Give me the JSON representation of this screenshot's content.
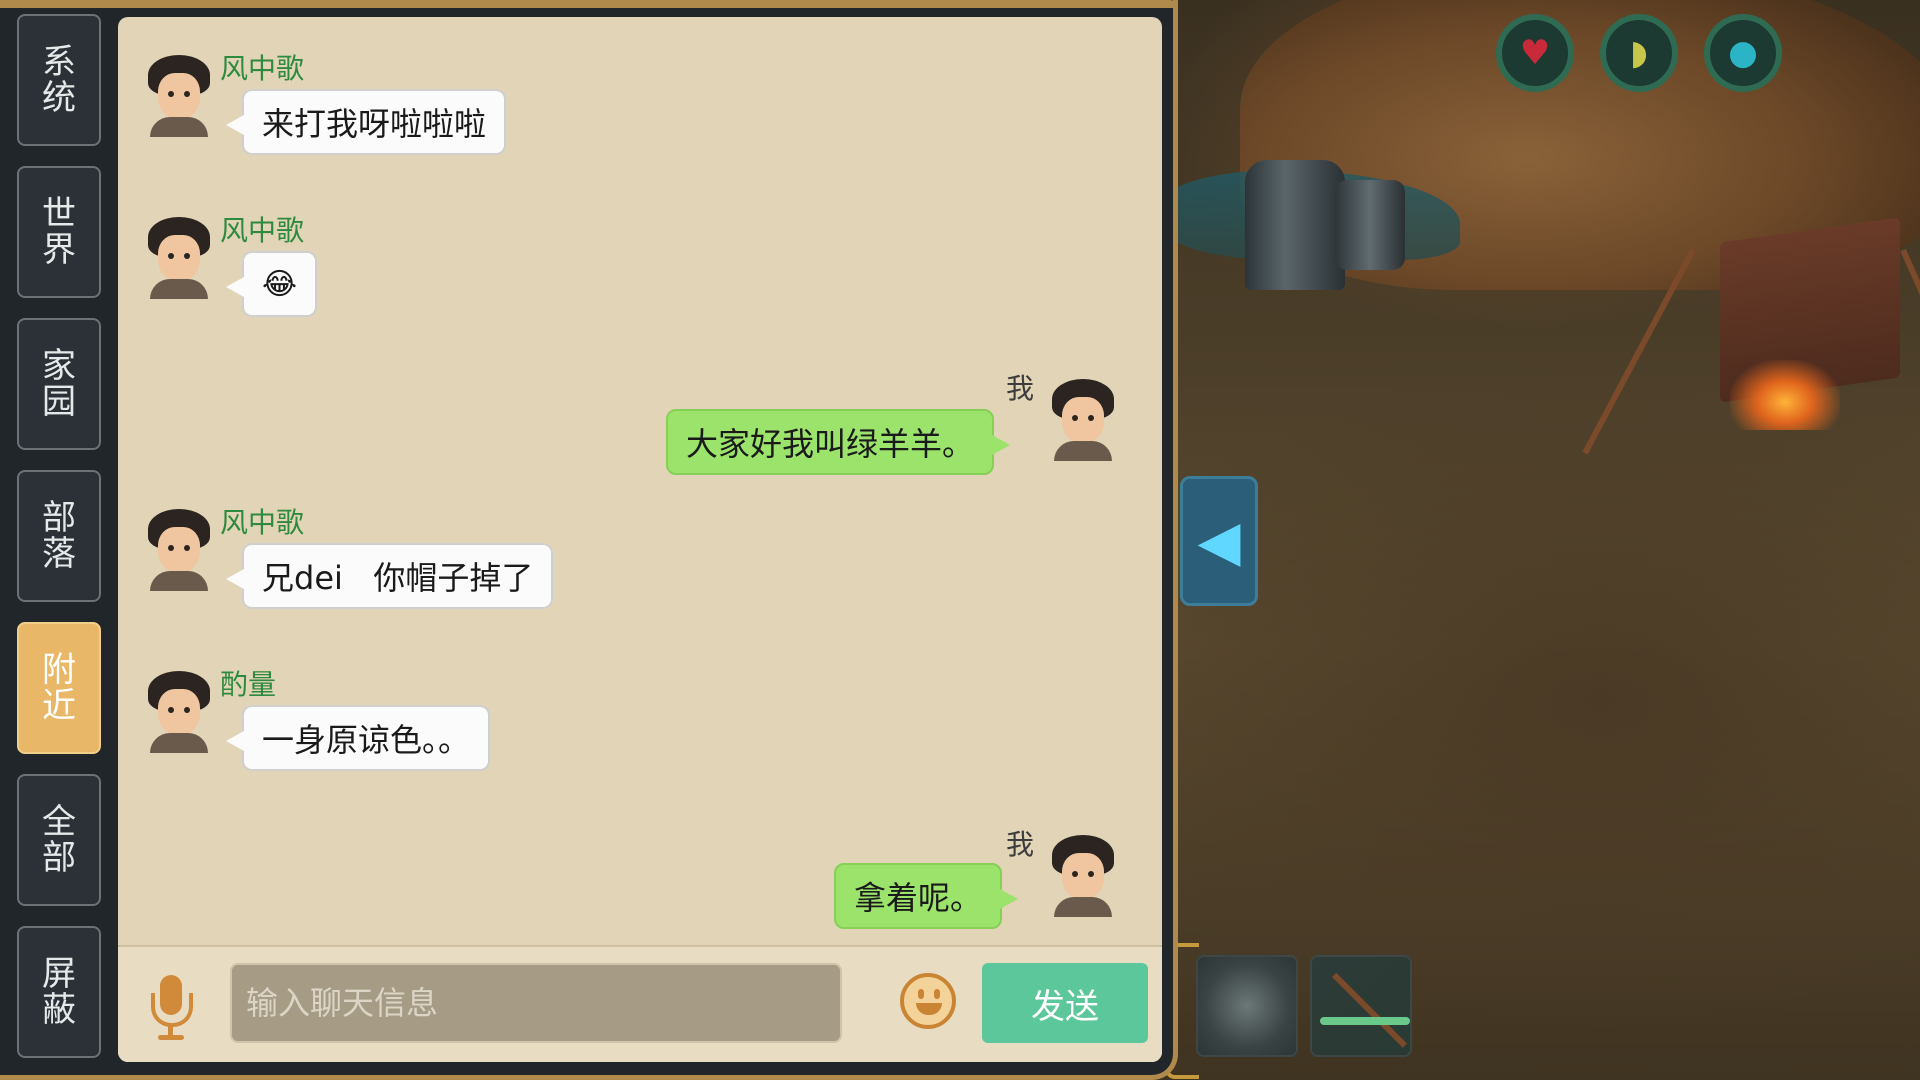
{
  "status_icons": [
    "heart-icon",
    "food-icon",
    "water-icon"
  ],
  "tabs": [
    {
      "label": "系统",
      "active": false
    },
    {
      "label": "世界",
      "active": false
    },
    {
      "label": "家园",
      "active": false
    },
    {
      "label": "部落",
      "active": false
    },
    {
      "label": "附近",
      "active": true
    },
    {
      "label": "全部",
      "active": false
    },
    {
      "label": "屏蔽",
      "active": false
    }
  ],
  "messages": [
    {
      "side": "left",
      "name": "风中歌",
      "text": "来打我呀啦啦啦"
    },
    {
      "side": "left",
      "name": "风中歌",
      "text": "😂"
    },
    {
      "side": "right",
      "name": "我",
      "text": "大家好我叫绿羊羊。"
    },
    {
      "side": "left",
      "name": "风中歌",
      "text": "兄dei   你帽子掉了"
    },
    {
      "side": "left",
      "name": "酌量",
      "text": "一身原谅色。。"
    },
    {
      "side": "right",
      "name": "我",
      "text": "拿着呢。"
    }
  ],
  "input": {
    "placeholder": "输入聊天信息",
    "value": ""
  },
  "send_label": "发送",
  "colors": {
    "panel_bg": "#e2d4b6",
    "active_tab": "#e8b868",
    "my_bubble": "#9be36a",
    "other_name": "#2e8a3e",
    "send_button": "#5cc79a"
  }
}
